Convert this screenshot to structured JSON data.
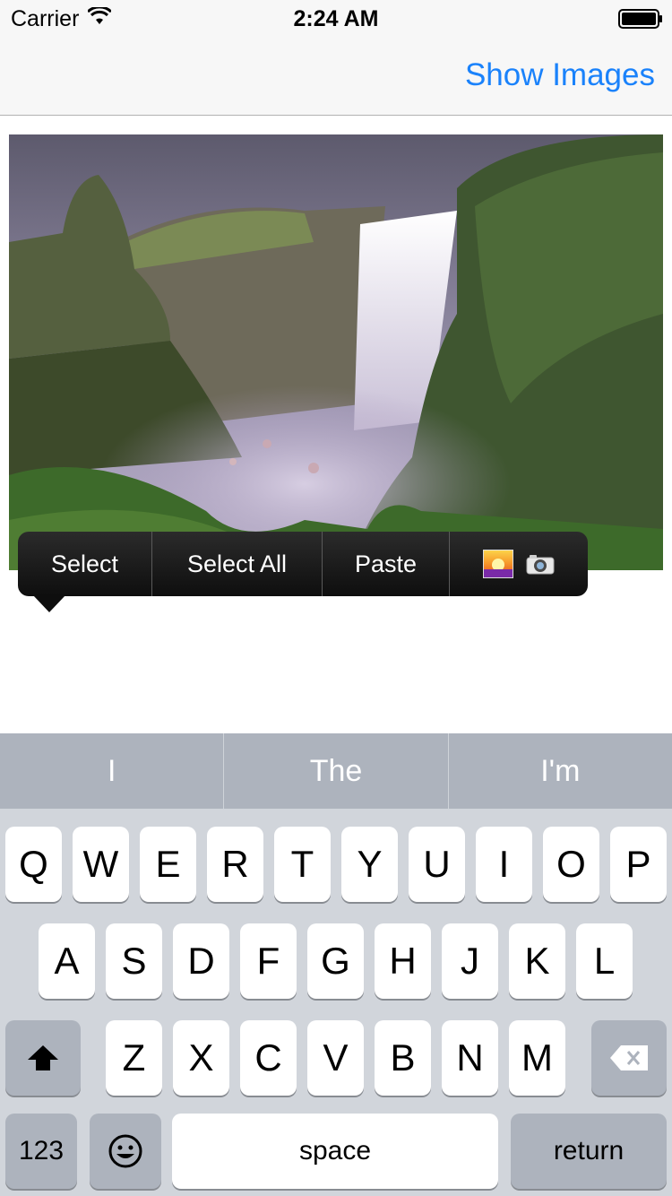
{
  "status_bar": {
    "carrier": "Carrier",
    "time": "2:24 AM"
  },
  "nav": {
    "right_button": "Show Images"
  },
  "photo": {
    "subject": "waterfall-landscape"
  },
  "edit_menu": {
    "items": [
      "Select",
      "Select All",
      "Paste"
    ],
    "icons": [
      "photo-library-icon",
      "camera-icon"
    ]
  },
  "keyboard": {
    "predictions": [
      "I",
      "The",
      "I'm"
    ],
    "row1": [
      "Q",
      "W",
      "E",
      "R",
      "T",
      "Y",
      "U",
      "I",
      "O",
      "P"
    ],
    "row2": [
      "A",
      "S",
      "D",
      "F",
      "G",
      "H",
      "J",
      "K",
      "L"
    ],
    "row3": [
      "Z",
      "X",
      "C",
      "V",
      "B",
      "N",
      "M"
    ],
    "bottom": {
      "numbers": "123",
      "space": "space",
      "return": "return"
    }
  },
  "colors": {
    "accent": "#1a82fb",
    "keyboard_bg": "#d1d5db",
    "dark_key": "#adb3bd"
  }
}
